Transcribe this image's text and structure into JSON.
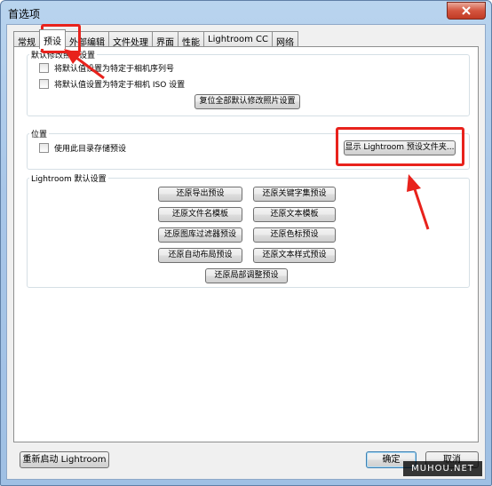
{
  "window": {
    "title": "首选项"
  },
  "tabs": [
    {
      "label": "常规"
    },
    {
      "label": "预设"
    },
    {
      "label": "外部编辑"
    },
    {
      "label": "文件处理"
    },
    {
      "label": "界面"
    },
    {
      "label": "性能"
    },
    {
      "label": "Lightroom CC"
    },
    {
      "label": "网络"
    }
  ],
  "develop_defaults": {
    "label": "默认修改照片设置",
    "checkbox_serial": "将默认值设置为特定于相机序列号",
    "checkbox_iso": "将默认值设置为特定于相机 ISO 设置",
    "reset_button": "复位全部默认修改照片设置"
  },
  "location": {
    "label": "位置",
    "checkbox_store": "使用此目录存储预设",
    "show_folder_button": "显示 Lightroom 预设文件夹..."
  },
  "lightroom_defaults": {
    "label": "Lightroom 默认设置",
    "buttons": [
      "还原导出预设",
      "还原关键字集预设",
      "还原文件名模板",
      "还原文本模板",
      "还原图库过滤器预设",
      "还原色标预设",
      "还原自动布局预设",
      "还原文本样式预设",
      "还原局部调整预设"
    ]
  },
  "footer": {
    "restart_button": "重新启动 Lightroom",
    "ok_button": "确定",
    "cancel_button": "取消"
  },
  "watermark": "MUHOU.NET",
  "colors": {
    "highlight": "#e8221c"
  }
}
